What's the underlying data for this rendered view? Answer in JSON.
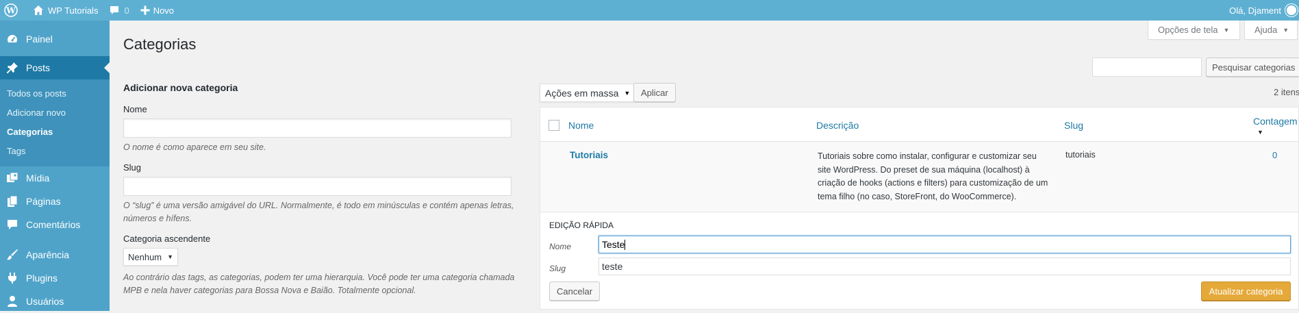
{
  "adminbar": {
    "site_name": "WP Tutorials",
    "comments_count": "0",
    "new_label": "Novo",
    "greeting": "Olá, Djament"
  },
  "sidebar": {
    "items": [
      {
        "label": "Painel",
        "icon": "dashboard-icon"
      },
      {
        "label": "Posts",
        "icon": "pin-icon"
      },
      {
        "label": "Mídia",
        "icon": "media-icon"
      },
      {
        "label": "Páginas",
        "icon": "pages-icon"
      },
      {
        "label": "Comentários",
        "icon": "comment-icon"
      },
      {
        "label": "Aparência",
        "icon": "brush-icon"
      },
      {
        "label": "Plugins",
        "icon": "plug-icon"
      },
      {
        "label": "Usuários",
        "icon": "users-icon"
      }
    ],
    "submenu": [
      "Todos os posts",
      "Adicionar novo",
      "Categorias",
      "Tags"
    ]
  },
  "screen": {
    "options_label": "Opções de tela",
    "help_label": "Ajuda"
  },
  "page_title": "Categorias",
  "search": {
    "button_label": "Pesquisar categorias"
  },
  "form": {
    "heading": "Adicionar nova categoria",
    "name_label": "Nome",
    "name_hint": "O nome é como aparece em seu site.",
    "slug_label": "Slug",
    "slug_hint": "O “slug” é uma versão amigável do URL. Normalmente, é todo em minúsculas e contém apenas letras, números e hífens.",
    "parent_label": "Categoria ascendente",
    "parent_value": "Nenhum",
    "parent_hint": "Ao contrário das tags, as categorias, podem ter uma hierarquia. Você pode ter uma categoria chamada MPB e nela haver categorias para Bossa Nova e Baião. Totalmente opcional."
  },
  "bulk": {
    "select_label": "Ações em massa",
    "apply_label": "Aplicar",
    "items_count": "2 itens"
  },
  "table": {
    "columns": {
      "name": "Nome",
      "description": "Descrição",
      "slug": "Slug",
      "count": "Contagem"
    },
    "rows": [
      {
        "name": "Tutoriais",
        "description": "Tutoriais sobre como instalar, configurar e customizar seu site WordPress. Do preset de sua máquina (localhost) à criação de hooks (actions e filters) para customização de um tema filho (no caso, StoreFront, do WooCommerce).",
        "slug": "tutoriais",
        "count": "0"
      }
    ]
  },
  "quick_edit": {
    "title": "EDIÇÃO RÁPIDA",
    "name_label": "Nome",
    "name_value": "Teste",
    "slug_label": "Slug",
    "slug_value": "teste",
    "cancel_label": "Cancelar",
    "update_label": "Atualizar categoria"
  },
  "colors": {
    "adminbar": "#5eb0d3",
    "sidebar": "#4fa3c9",
    "sidebar_current": "#1e79a6",
    "link": "#1e79a6",
    "primary_button": "#e5a93a"
  }
}
